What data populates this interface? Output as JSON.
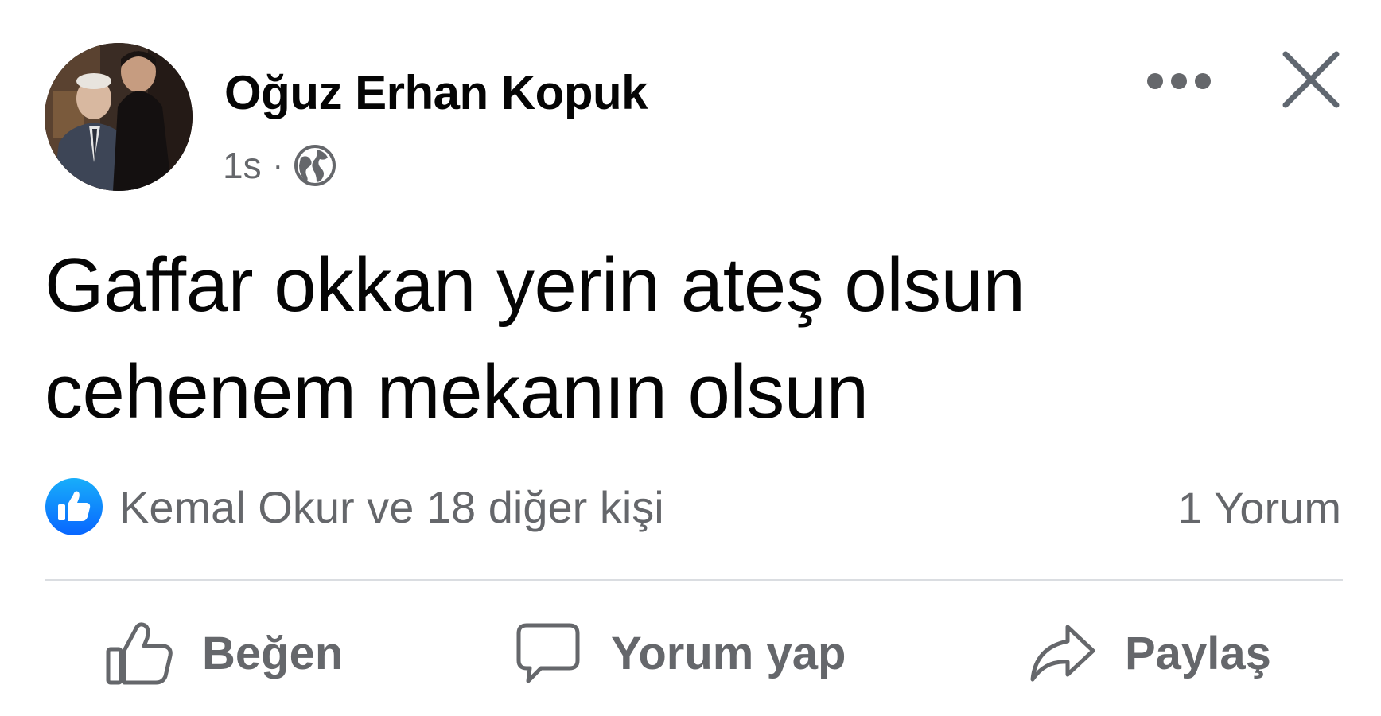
{
  "post": {
    "author": "Oğuz Erhan Kopuk",
    "time": "1s",
    "separator": "·",
    "privacy_icon": "globe-icon",
    "text_lines": [
      "Gaffar okkan yerin ateş olsun",
      "cehenem mekanın olsun"
    ]
  },
  "reactions": {
    "icon": "like-icon",
    "summary": "Kemal Okur ve 18 diğer kişi",
    "comments": "1 Yorum"
  },
  "actions": {
    "like": "Beğen",
    "comment": "Yorum yap",
    "share": "Paylaş"
  },
  "colors": {
    "text_primary": "#050505",
    "text_secondary": "#65676b",
    "like_blue": "#1877f2",
    "divider": "#dadde1"
  }
}
